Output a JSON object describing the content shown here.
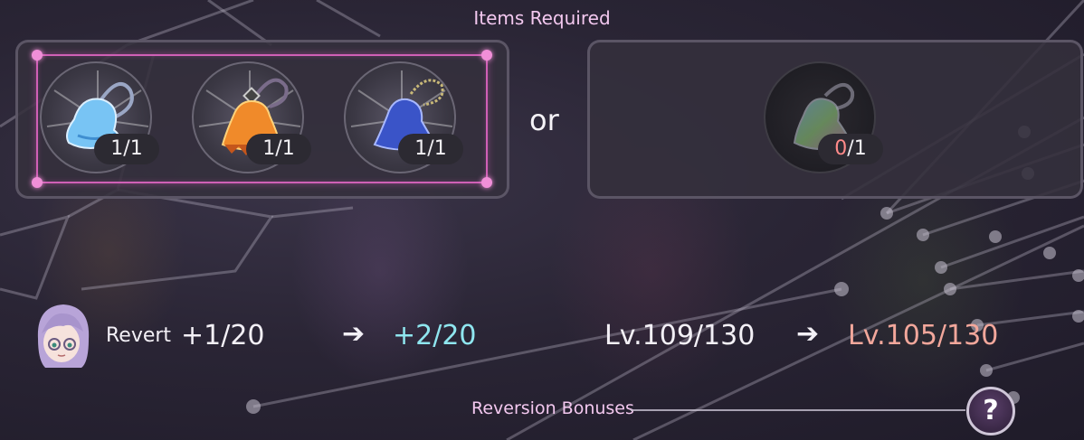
{
  "header": {
    "title": "Items Required"
  },
  "option_a": {
    "items": [
      {
        "name": "blue-bell-charm",
        "have": "1",
        "need": "1",
        "icon": "blue-bell-icon",
        "color": "#6fb8f0"
      },
      {
        "name": "orange-bell-charm",
        "have": "1",
        "need": "1",
        "icon": "orange-bell-icon",
        "color": "#f08a2a"
      },
      {
        "name": "navy-bell-charm",
        "have": "1",
        "need": "1",
        "icon": "navy-bell-icon",
        "color": "#3a54c8"
      }
    ]
  },
  "separator": {
    "label": "or"
  },
  "option_b": {
    "items": [
      {
        "name": "rainbow-bell-charm",
        "have": "0",
        "need": "1",
        "icon": "rainbow-bell-icon",
        "color": "#7fb0c0"
      }
    ]
  },
  "reversion": {
    "label": "Revert",
    "current": "+1/20",
    "next": "+2/20",
    "level_current": "Lv.109/130",
    "level_next": "Lv.105/130"
  },
  "footer": {
    "bonus_label": "Reversion Bonuses",
    "help_label": "?"
  },
  "colors": {
    "accent_pink": "#f3c8ef",
    "frame_pink": "#d060b6",
    "cyan": "#8fe6ef",
    "salmon": "#f2a79b",
    "missing_red": "#ff8a8a"
  }
}
